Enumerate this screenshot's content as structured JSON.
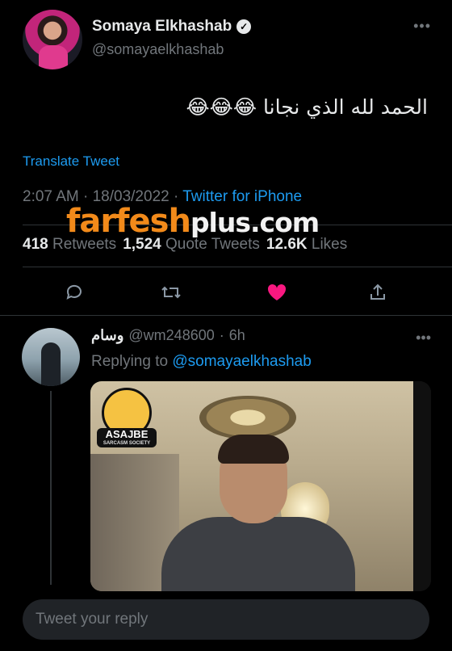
{
  "tweet": {
    "author_name": "Somaya Elkhashab",
    "author_handle": "@somayaelkhashab",
    "verified_icon": "verified-badge-icon",
    "text": "الحمد لله الذي نجانا 😂😂😂",
    "translate_label": "Translate Tweet",
    "time": "2:07 AM",
    "separator": "·",
    "date": "18/03/2022",
    "source": "Twitter for iPhone",
    "stats": [
      {
        "count": "418",
        "label": "Retweets"
      },
      {
        "count": "1,524",
        "label": "Quote Tweets"
      },
      {
        "count": "12.6K",
        "label": "Likes"
      }
    ],
    "actions": [
      "reply-icon",
      "retweet-icon",
      "like-icon",
      "share-icon"
    ],
    "liked_color": "#f91880"
  },
  "watermark": {
    "part1": "farfesh",
    "part2": "plus.com"
  },
  "reply": {
    "author_name": "وسام",
    "author_handle": "@wm248600",
    "separator": "·",
    "time": "6h",
    "replying_prefix": "Replying to",
    "replying_to": "@somayaelkhashab",
    "sticker_title": "ASAJBE",
    "sticker_subtitle": "SARCASM SOCIETY"
  },
  "composer": {
    "placeholder": "Tweet your reply"
  },
  "colors": {
    "accent": "#1d9bf0",
    "background": "#000000",
    "muted": "#71767b"
  }
}
